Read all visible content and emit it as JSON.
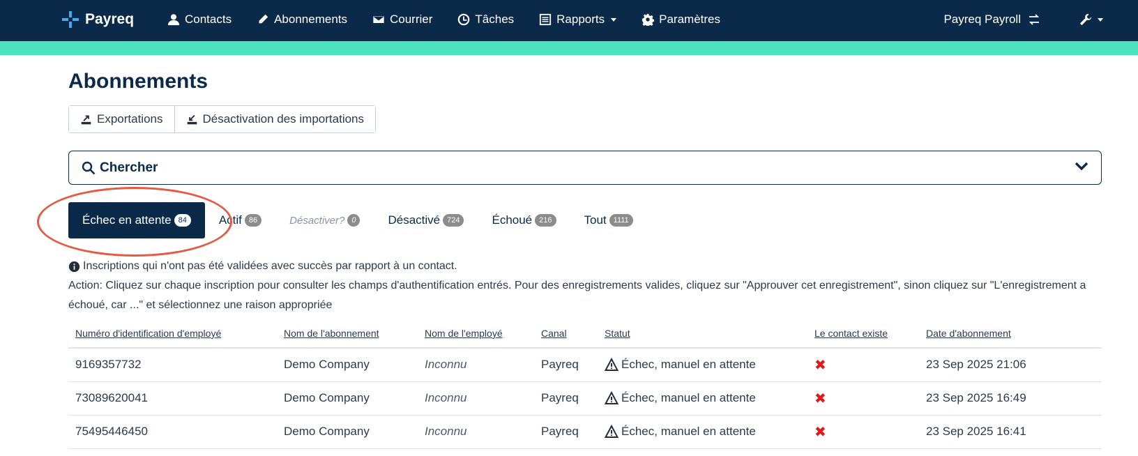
{
  "nav": {
    "brand": "Payreq",
    "items": [
      {
        "label": "Contacts",
        "icon": "user-icon"
      },
      {
        "label": "Abonnements",
        "icon": "pencil-icon"
      },
      {
        "label": "Courrier",
        "icon": "envelope-icon"
      },
      {
        "label": "Tâches",
        "icon": "clock-icon"
      },
      {
        "label": "Rapports",
        "icon": "report-icon",
        "dropdown": true
      },
      {
        "label": "Paramètres",
        "icon": "gear-icon"
      }
    ],
    "org_label": "Payreq Payroll",
    "accent_color": "#4be3bd",
    "bar_color": "#0b2a4a"
  },
  "page": {
    "title": "Abonnements",
    "buttons": {
      "exports": "Exportations",
      "import_disable": "Désactivation des importations"
    },
    "search_label": "Chercher"
  },
  "tabs": [
    {
      "label": "Échec en attente",
      "count": "84",
      "active": true
    },
    {
      "label": "Actif",
      "count": "86"
    },
    {
      "label": "Désactiver?",
      "count": "0",
      "muted": true
    },
    {
      "label": "Désactivé",
      "count": "724"
    },
    {
      "label": "Échoué",
      "count": "216"
    },
    {
      "label": "Tout",
      "count": "1111"
    }
  ],
  "info": {
    "line1": "Inscriptions qui n'ont pas été validées avec succès par rapport à un contact.",
    "line2": "Action: Cliquez sur chaque inscription pour consulter les champs d'authentification entrés. Pour des enregistrements valides, cliquez sur \"Approuver cet enregistrement\", sinon cliquez sur \"L'enregistrement a échoué, car ...\" et sélectionnez une raison appropriée"
  },
  "table": {
    "headers": [
      "Numéro d'identification d'employé",
      "Nom de l'abonnement",
      "Nom de l'employé",
      "Canal",
      "Statut",
      "Le contact existe",
      "Date d'abonnement"
    ],
    "rows": [
      {
        "id": "9169357732",
        "subscription": "Demo Company",
        "employee": "Inconnu",
        "channel": "Payreq",
        "status": "Échec, manuel en attente",
        "contact_exists": "✖",
        "date": "23 Sep 2025 21:06"
      },
      {
        "id": "73089620041",
        "subscription": "Demo Company",
        "employee": "Inconnu",
        "channel": "Payreq",
        "status": "Échec, manuel en attente",
        "contact_exists": "✖",
        "date": "23 Sep 2025 16:49"
      },
      {
        "id": "75495446450",
        "subscription": "Demo Company",
        "employee": "Inconnu",
        "channel": "Payreq",
        "status": "Échec, manuel en attente",
        "contact_exists": "✖",
        "date": "23 Sep 2025 16:41"
      }
    ]
  }
}
